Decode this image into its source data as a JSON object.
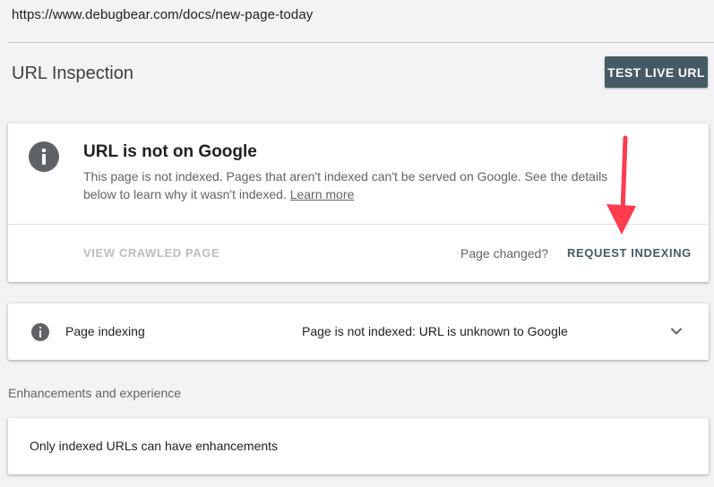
{
  "url_bar": {
    "url": "https://www.debugbear.com/docs/new-page-today"
  },
  "header": {
    "title": "URL Inspection",
    "test_live_url_label": "TEST LIVE URL"
  },
  "status_card": {
    "icon": "info-icon",
    "title": "URL is not on Google",
    "description": "This page is not indexed. Pages that aren't indexed can't be served on Google. See the details below to learn why it wasn't indexed.",
    "learn_more": "Learn more",
    "view_crawled_label": "VIEW CRAWLED PAGE",
    "page_changed_label": "Page changed?",
    "request_indexing_label": "REQUEST INDEXING",
    "annotation_arrow_color": "#ff3b4f"
  },
  "page_indexing": {
    "icon": "info-icon",
    "label": "Page indexing",
    "status": "Page is not indexed: URL is unknown to Google",
    "expand_icon": "chevron-down-icon"
  },
  "enhancements": {
    "heading": "Enhancements and experience",
    "message": "Only indexed URLs can have enhancements"
  },
  "colors": {
    "background": "#f1f3f4",
    "primary_button": "#455a64",
    "icon_gray": "#5f6368",
    "disabled_text": "#bdbdbd"
  }
}
